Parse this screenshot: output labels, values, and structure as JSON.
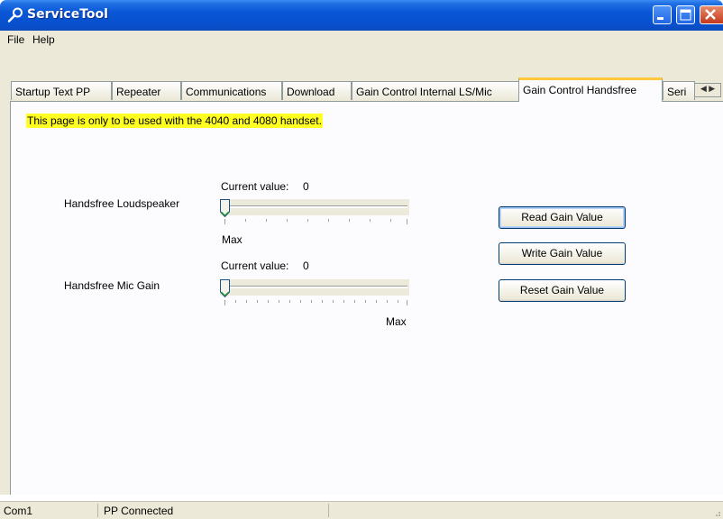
{
  "window": {
    "title": "ServiceTool"
  },
  "menu": {
    "items": [
      "File",
      "Help"
    ]
  },
  "tabs": [
    {
      "label": "Startup Text PP"
    },
    {
      "label": "Repeater"
    },
    {
      "label": "Communications"
    },
    {
      "label": "Download"
    },
    {
      "label": "Gain Control Internal LS/Mic"
    },
    {
      "label": "Gain Control Handsfree",
      "active": true
    },
    {
      "label": "Seri"
    }
  ],
  "content": {
    "warning": "This page is only to be used with the 4040 and 4080 handset.",
    "loudspeaker": {
      "label": "Handsfree Loudspeaker",
      "current_value_text": "Current value:",
      "current_value": "0",
      "max_label": "Max",
      "slider_value": 0
    },
    "mic": {
      "label": "Handsfree Mic Gain",
      "current_value_text": "Current value:",
      "current_value": "0",
      "max_label": "Max",
      "slider_value": 0
    },
    "buttons": {
      "read": "Read Gain Value",
      "write": "Write Gain Value",
      "reset": "Reset Gain Value"
    }
  },
  "status": {
    "port": "Com1",
    "connection": "PP Connected"
  },
  "colors": {
    "title_blue": "#0a56d6",
    "warning_yellow": "#ffff22",
    "active_tab_accent": "#ffc83c"
  }
}
